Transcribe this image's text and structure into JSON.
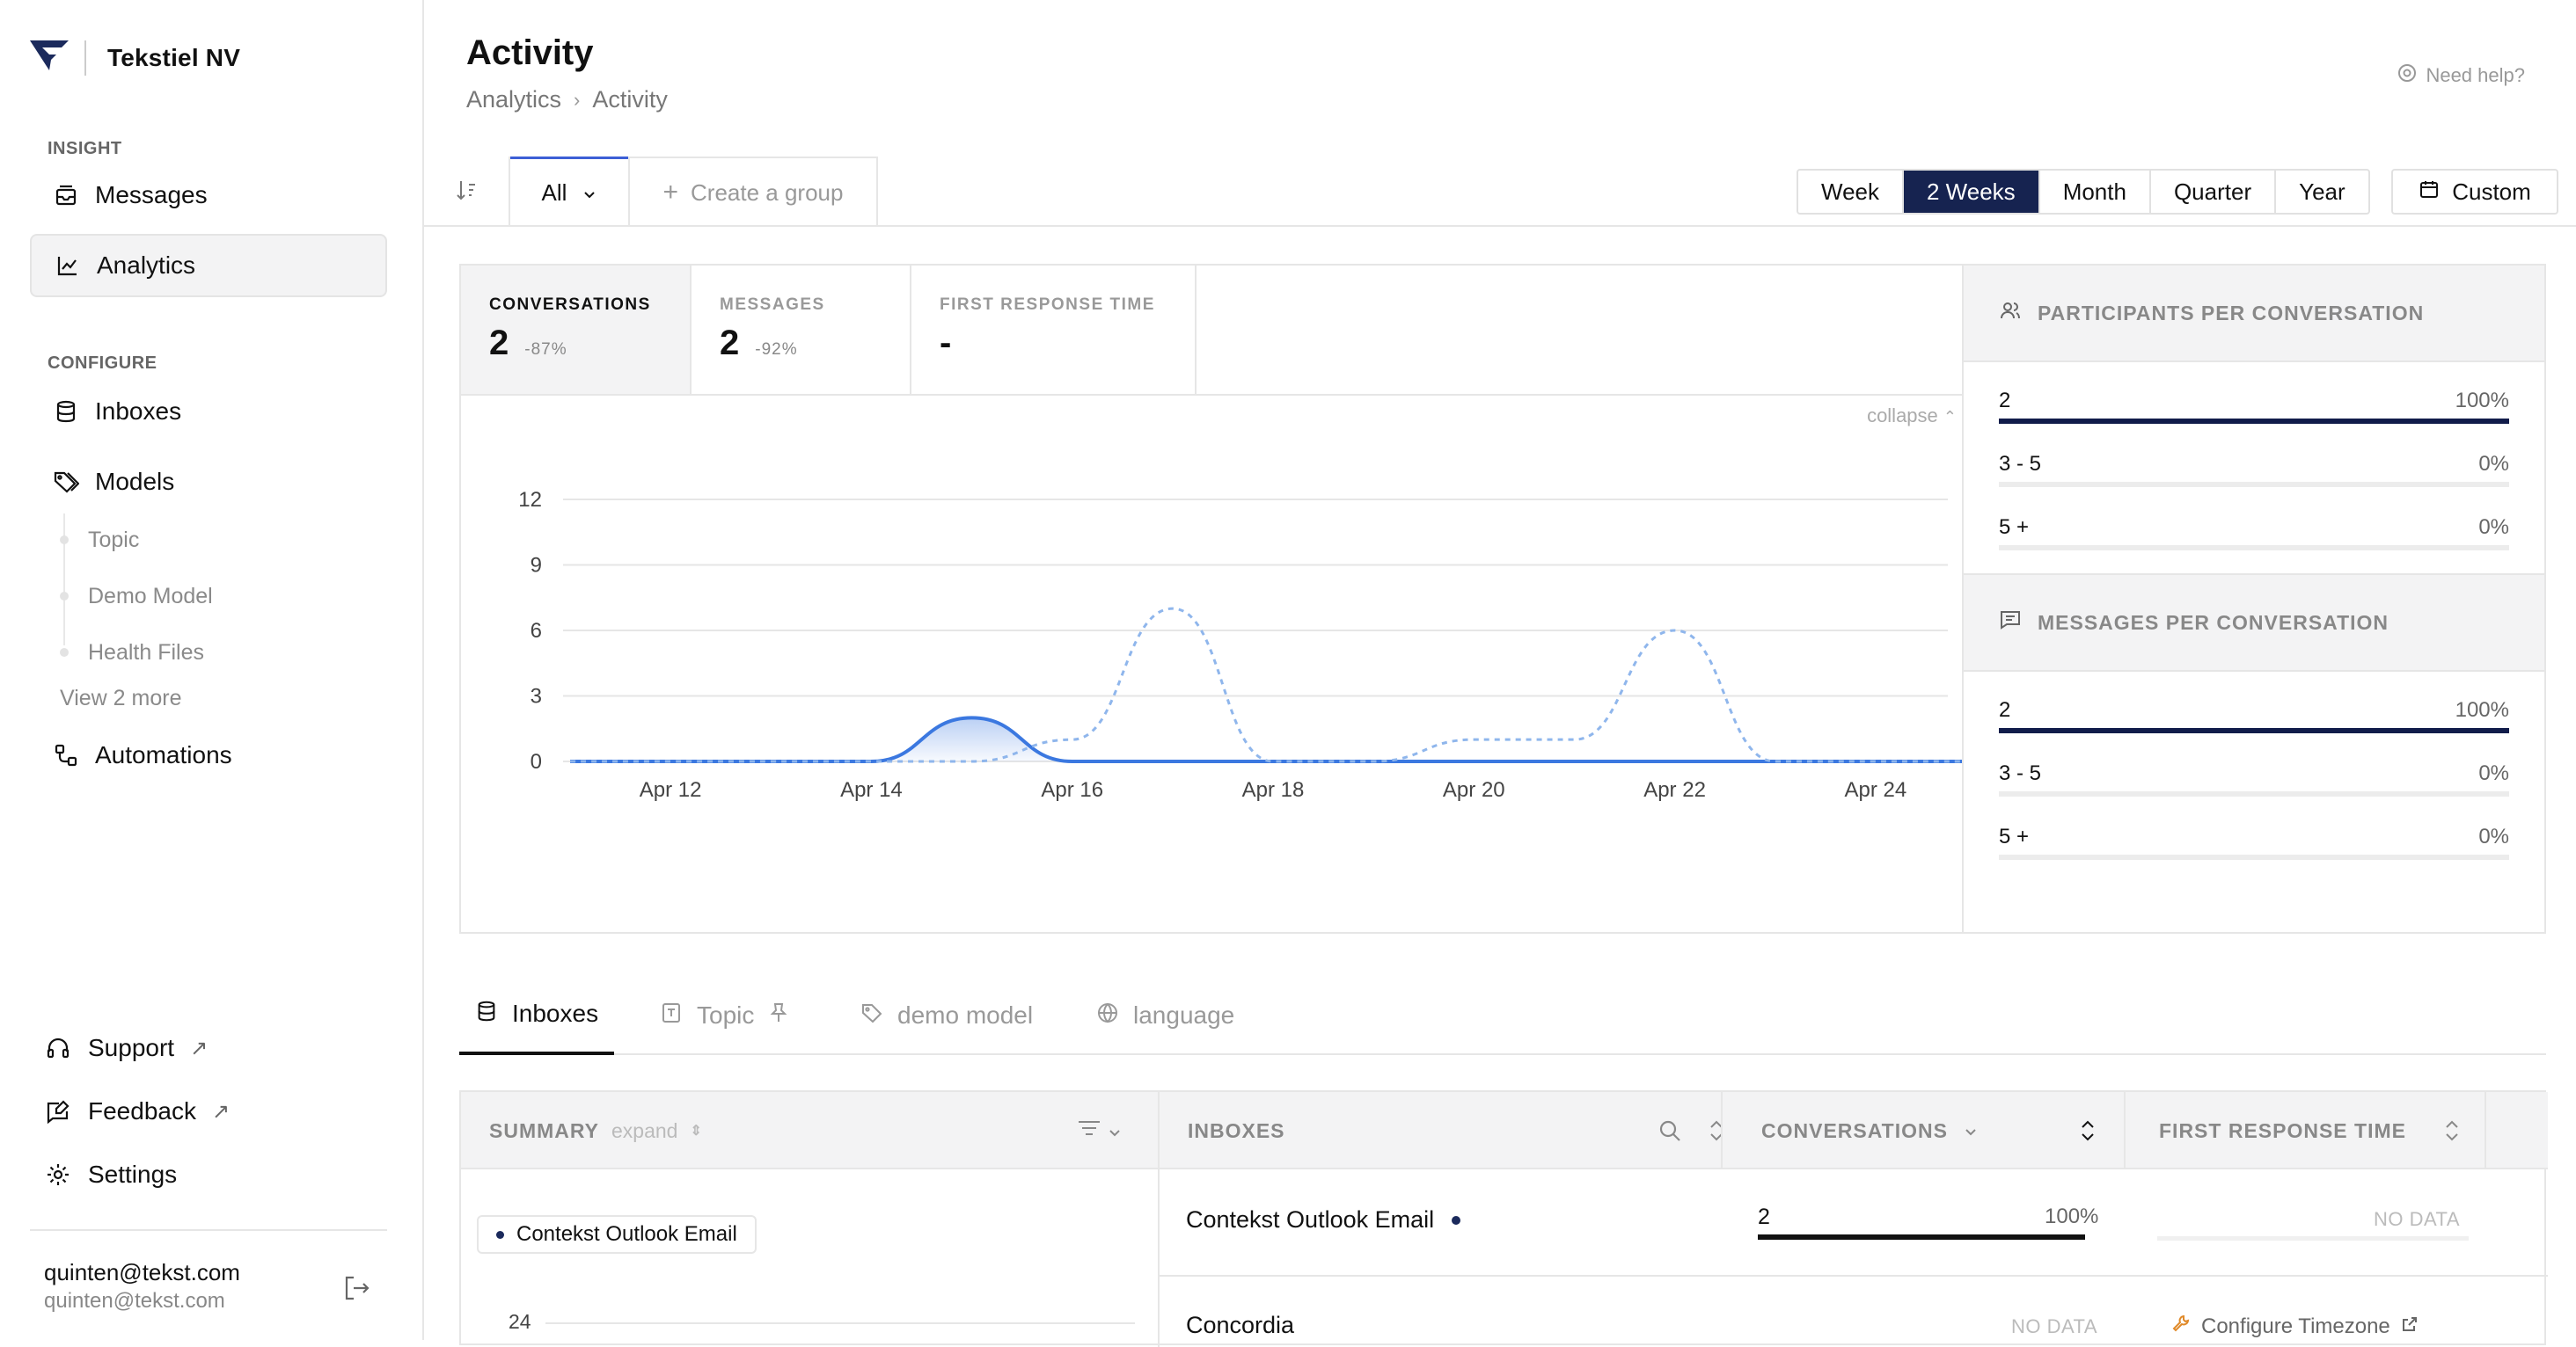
{
  "org": {
    "name": "Tekstiel NV"
  },
  "sidebar": {
    "insight_label": "INSIGHT",
    "messages_label": "Messages",
    "analytics_label": "Analytics",
    "configure_label": "CONFIGURE",
    "inboxes_label": "Inboxes",
    "models_label": "Models",
    "models": [
      "Topic",
      "Demo Model",
      "Health Files"
    ],
    "view_more": "View 2 more",
    "automations_label": "Automations",
    "support_label": "Support",
    "feedback_label": "Feedback",
    "settings_label": "Settings"
  },
  "user": {
    "name": "quinten@tekst.com",
    "email": "quinten@tekst.com"
  },
  "header": {
    "title": "Activity",
    "breadcrumb": [
      "Analytics",
      "Activity"
    ],
    "help": "Need help?"
  },
  "toolbar": {
    "group_filter": "All",
    "create_group": "Create a group",
    "periods": [
      "Week",
      "2 Weeks",
      "Month",
      "Quarter",
      "Year"
    ],
    "selected_period": "2 Weeks",
    "custom": "Custom"
  },
  "metrics": [
    {
      "label": "CONVERSATIONS",
      "value": "2",
      "delta": "-87%"
    },
    {
      "label": "MESSAGES",
      "value": "2",
      "delta": "-92%"
    },
    {
      "label": "FIRST RESPONSE TIME",
      "value": "-",
      "delta": ""
    }
  ],
  "collapse_label": "collapse",
  "chart_data": {
    "type": "line",
    "x": [
      "Apr 11",
      "Apr 12",
      "Apr 13",
      "Apr 14",
      "Apr 15",
      "Apr 16",
      "Apr 17",
      "Apr 18",
      "Apr 19",
      "Apr 20",
      "Apr 21",
      "Apr 22",
      "Apr 23",
      "Apr 24",
      "Apr 25"
    ],
    "x_tick_labels": [
      "Apr 12",
      "Apr 14",
      "Apr 16",
      "Apr 18",
      "Apr 20",
      "Apr 22",
      "Apr 24"
    ],
    "y_ticks": [
      0,
      3,
      6,
      9,
      12
    ],
    "ylim": [
      0,
      12
    ],
    "series": [
      {
        "style": "solid",
        "color": "#3b78e0",
        "area": true,
        "values": [
          0,
          0,
          0,
          0,
          2,
          0,
          0,
          0,
          0,
          0,
          0,
          0,
          0,
          0,
          0
        ]
      },
      {
        "style": "dashed",
        "color": "#8fb6ec",
        "area": false,
        "values": [
          0,
          0,
          0,
          0,
          0,
          1,
          7,
          0,
          0,
          1,
          1,
          6,
          0,
          0,
          0
        ]
      }
    ],
    "grid": true
  },
  "participants": {
    "title": "PARTICIPANTS PER CONVERSATION",
    "rows": [
      {
        "label": "2",
        "value": "100%",
        "fraction": 1.0
      },
      {
        "label": "3 - 5",
        "value": "0%",
        "fraction": 0
      },
      {
        "label": "5 +",
        "value": "0%",
        "fraction": 0
      }
    ]
  },
  "messages_per": {
    "title": "MESSAGES PER CONVERSATION",
    "rows": [
      {
        "label": "2",
        "value": "100%",
        "fraction": 1.0
      },
      {
        "label": "3 - 5",
        "value": "0%",
        "fraction": 0
      },
      {
        "label": "5 +",
        "value": "0%",
        "fraction": 0
      }
    ]
  },
  "tabs": [
    "Inboxes",
    "Topic",
    "demo model",
    "language"
  ],
  "table": {
    "summary_header": "SUMMARY",
    "expand_label": "expand",
    "inboxes_header": "INBOXES",
    "conversations_header": "CONVERSATIONS",
    "frt_header": "FIRST RESPONSE TIME",
    "chip_label": "Contekst Outlook Email",
    "mini_axis_top": "24",
    "rows": [
      {
        "inbox": "Contekst Outlook Email",
        "conversations": "2",
        "conv_pct": "100%",
        "conv_fraction": 1.0,
        "frt": "NO DATA"
      },
      {
        "inbox": "Concordia",
        "conversations": "NO DATA",
        "frt": "Configure Timezone"
      }
    ]
  }
}
